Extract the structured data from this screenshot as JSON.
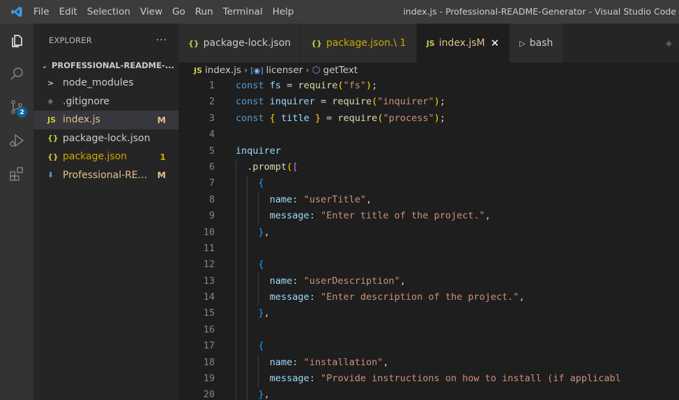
{
  "menu": [
    "File",
    "Edit",
    "Selection",
    "View",
    "Go",
    "Run",
    "Terminal",
    "Help"
  ],
  "window_title": "index.js - Professional-README-Generator - Visual Studio Code",
  "activity": {
    "source_control_badge": "2"
  },
  "explorer": {
    "title": "EXPLORER",
    "more": "···",
    "folder": "PROFESSIONAL-README-...",
    "items": [
      {
        "icon": ">",
        "name": "node_modules",
        "status": "",
        "color": "#cccccc",
        "icon_color": "#cccccc"
      },
      {
        "icon": "◈",
        "name": ".gitignore",
        "status": "",
        "color": "#cccccc",
        "icon_color": "#6d8086"
      },
      {
        "icon": "JS",
        "name": "index.js",
        "status": "M",
        "color": "#e2c08d",
        "icon_color": "#cbcb41"
      },
      {
        "icon": "{}",
        "name": "package-lock.json",
        "status": "",
        "color": "#cccccc",
        "icon_color": "#cbcb41"
      },
      {
        "icon": "{}",
        "name": "package.json",
        "status": "1",
        "color": "#cca700",
        "icon_color": "#cbcb41"
      },
      {
        "icon": "⬇",
        "name": "Professional-RE...",
        "status": "M",
        "color": "#e2c08d",
        "icon_color": "#519aba"
      }
    ]
  },
  "tabs": [
    {
      "icon": "{}",
      "label": "package-lock.json",
      "suffix": "",
      "close": "",
      "color": "#cccccc",
      "icon_color": "#cbcb41",
      "active": false
    },
    {
      "icon": "{}",
      "label": "package.json",
      "suffix": " .\\ 1",
      "close": "",
      "color": "#cca700",
      "icon_color": "#cbcb41",
      "active": false
    },
    {
      "icon": "JS",
      "label": "index.js",
      "suffix": " M",
      "close": "✕",
      "color": "#e2c08d",
      "icon_color": "#cbcb41",
      "active": true
    },
    {
      "icon": "▷",
      "label": "bash",
      "suffix": "",
      "close": "",
      "color": "#cccccc",
      "icon_color": "#cccccc",
      "active": false
    }
  ],
  "breadcrumb": [
    "index.js",
    "licenser",
    "getText"
  ],
  "colors": {
    "modified": "#e2c08d",
    "warning": "#cca700",
    "keyword": "#569cd6",
    "variable": "#9cdcfe",
    "function": "#dcdcaa",
    "string": "#ce9178"
  }
}
